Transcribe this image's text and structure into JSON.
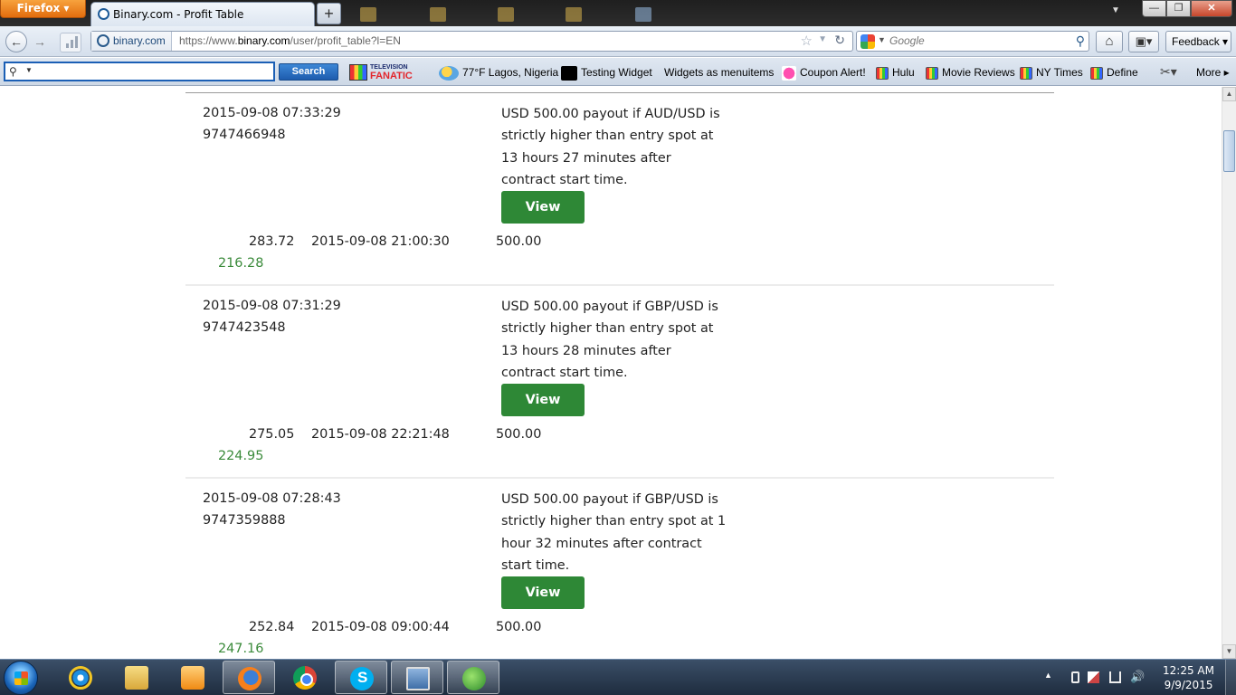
{
  "browser": {
    "menu_button": "Firefox",
    "tab_title": "Binary.com - Profit Table",
    "tab_close": "✕",
    "new_tab": "+",
    "window_minimize": "—",
    "window_maximize": "❐",
    "window_close": "✕"
  },
  "navbar": {
    "identity": "binary.com",
    "url_prefix": "https://www.",
    "url_domain": "binary.com",
    "url_path": "/user/profit_table?l=EN",
    "search_placeholder": "Google",
    "feedback": "Feedback"
  },
  "toolbar": {
    "search_button": "Search",
    "tv_fanatic_top": "TELEVISION",
    "tv_fanatic_bottom": "FANATIC",
    "weather": "77°F Lagos, Nigeria",
    "testing_widget": "Testing Widget",
    "widgets_menu": "Widgets as menuitems",
    "coupon": "Coupon Alert!",
    "hulu": "Hulu",
    "movie_reviews": "Movie Reviews",
    "ny_times": "NY Times",
    "define": "Define",
    "more": "More"
  },
  "rows": [
    {
      "purchase_date": "2015-09-08 07:33:29",
      "ref_id": "9747466948",
      "description": "USD 500.00 payout if AUD/USD is strictly higher than entry spot at 13 hours 27 minutes after contract start time.",
      "view_label": "View",
      "purchase_price": "283.72",
      "sale_date": "2015-09-08 21:00:30",
      "sale_price": "500.00",
      "profit": "216.28"
    },
    {
      "purchase_date": "2015-09-08 07:31:29",
      "ref_id": "9747423548",
      "description": "USD 500.00 payout if GBP/USD is strictly higher than entry spot at 13 hours 28 minutes after contract start time.",
      "view_label": "View",
      "purchase_price": "275.05",
      "sale_date": "2015-09-08 22:21:48",
      "sale_price": "500.00",
      "profit": "224.95"
    },
    {
      "purchase_date": "2015-09-08 07:28:43",
      "ref_id": "9747359888",
      "description": "USD 500.00 payout if GBP/USD is strictly higher than entry spot at 1 hour 32 minutes after contract start time.",
      "view_label": "View",
      "purchase_price": "252.84",
      "sale_date": "2015-09-08 09:00:44",
      "sale_price": "500.00",
      "profit": "247.16"
    }
  ],
  "taskbar": {
    "time": "12:25 AM",
    "date": "9/9/2015"
  },
  "colors": {
    "view_button": "#2e8836",
    "profit_text": "#3a8a3a",
    "search_button": "#1d5cae"
  }
}
